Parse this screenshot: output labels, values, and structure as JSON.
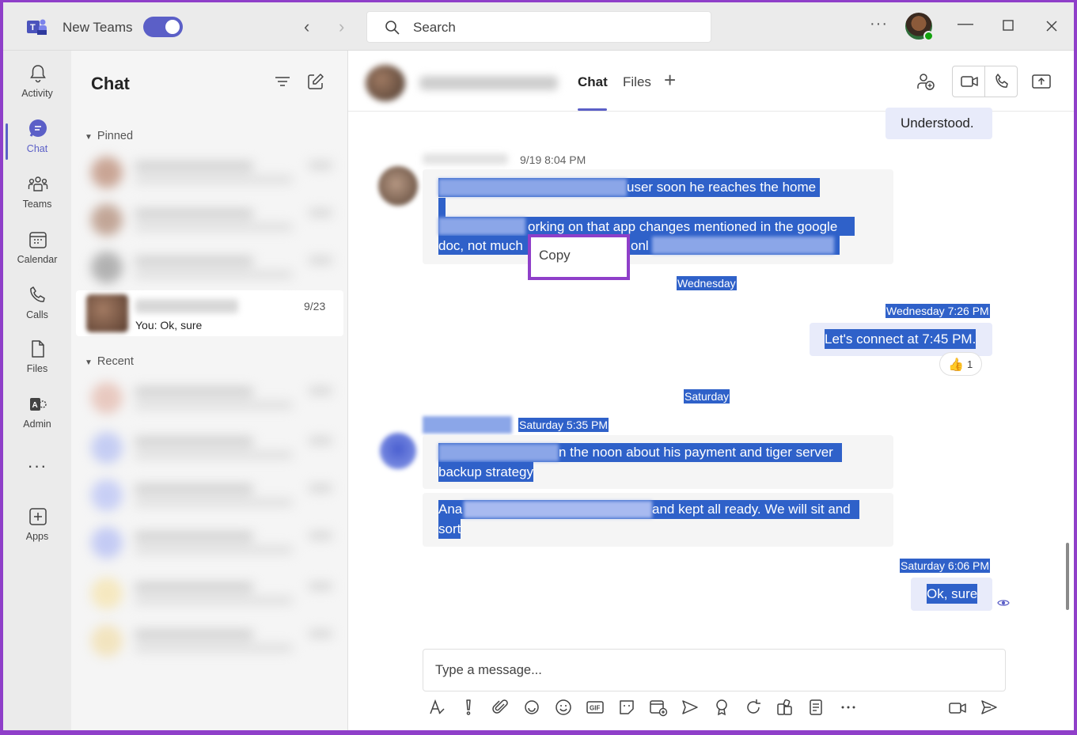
{
  "titlebar": {
    "app_name": "New Teams",
    "toggle_on": true,
    "search_placeholder": "Search",
    "more": "···",
    "brand_color": "#5b5fc7",
    "window_frame_color": "#8f3fc9"
  },
  "rail": {
    "items": [
      {
        "label": "Activity",
        "icon": "bell-icon"
      },
      {
        "label": "Chat",
        "icon": "chat-icon",
        "active": true
      },
      {
        "label": "Teams",
        "icon": "teams-icon"
      },
      {
        "label": "Calendar",
        "icon": "calendar-icon"
      },
      {
        "label": "Calls",
        "icon": "phone-icon"
      },
      {
        "label": "Files",
        "icon": "file-icon"
      },
      {
        "label": "Admin",
        "icon": "admin-icon"
      },
      {
        "label": "···",
        "icon": "more-icon"
      },
      {
        "label": "Apps",
        "icon": "apps-icon"
      }
    ]
  },
  "chat_list": {
    "title": "Chat",
    "pinned_label": "Pinned",
    "recent_label": "Recent",
    "active_chat": {
      "date": "9/23",
      "preview": "You: Ok, sure"
    }
  },
  "conversation": {
    "tabs": [
      {
        "label": "Chat",
        "active": true
      },
      {
        "label": "Files",
        "active": false
      }
    ],
    "messages": {
      "understood": "Understood.",
      "first_meta": "9/19 8:04 PM",
      "line1": "user soon he reaches the home",
      "line2": "orking on that app changes mentioned in the google",
      "line3a": "doc, not much",
      "line3b": "onl",
      "day_wednesday": "Wednesday",
      "wed_meta": "Wednesday 7:26 PM",
      "connect": "Let's connect at 7:45 PM.",
      "reaction_emoji": "👍",
      "reaction_count": "1",
      "day_saturday": "Saturday",
      "sat_meta": "Saturday 5:35 PM",
      "sat_line1": "n the noon about his payment and tiger server",
      "sat_line2": "backup strategy",
      "sat_line3a": "Ana",
      "sat_line3b": "and kept all ready. We will sit and",
      "sat_line4": "sort",
      "sat_meta2": "Saturday 6:06 PM",
      "ok_sure": "Ok, sure"
    },
    "context_menu": {
      "copy": "Copy"
    },
    "composer_placeholder": "Type a message..."
  }
}
